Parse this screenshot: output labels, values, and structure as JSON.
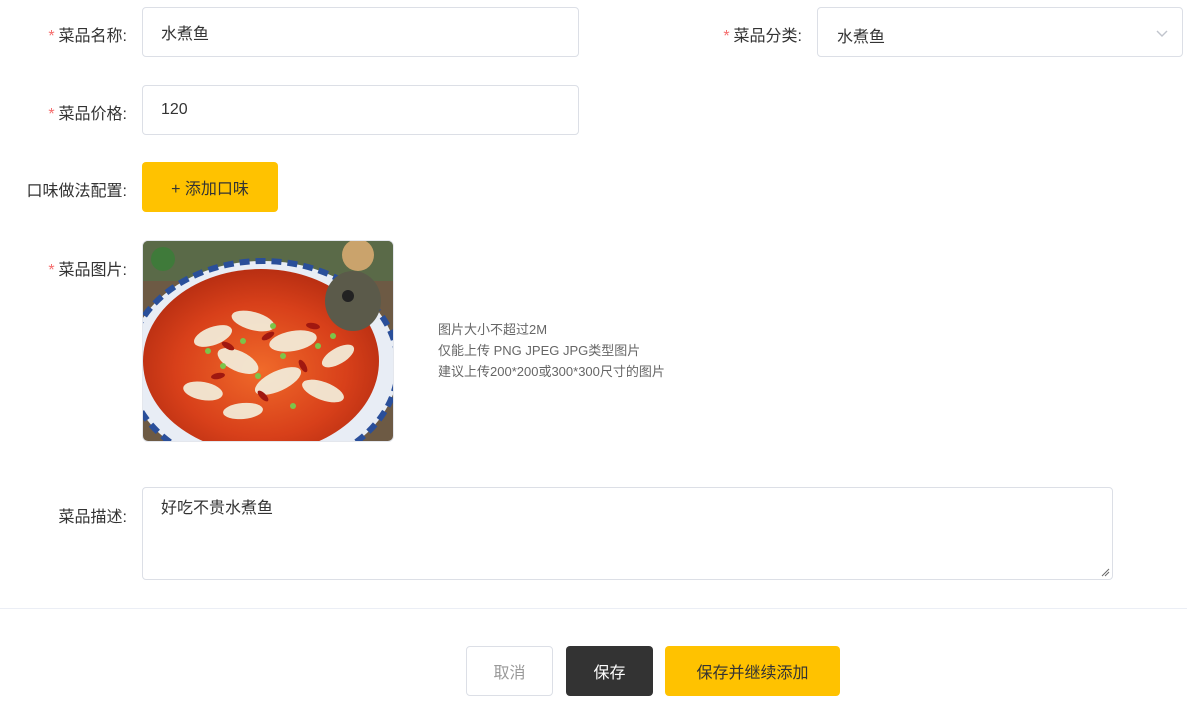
{
  "form": {
    "name": {
      "label": "菜品名称:",
      "required_mark": "*",
      "value": "水煮鱼"
    },
    "category": {
      "label": "菜品分类:",
      "required_mark": "*",
      "value": "水煮鱼",
      "icon": "chevron-down-icon"
    },
    "price": {
      "label": "菜品价格:",
      "required_mark": "*",
      "value": "120"
    },
    "flavor": {
      "label": "口味做法配置:",
      "add_button": "+ 添加口味"
    },
    "image": {
      "label": "菜品图片:",
      "required_mark": "*",
      "hints": [
        "图片大小不超过2M",
        "仅能上传 PNG JPEG JPG类型图片",
        "建议上传200*200或300*300尺寸的图片"
      ]
    },
    "description": {
      "label": "菜品描述:",
      "value": "好吃不贵水煮鱼"
    }
  },
  "actions": {
    "cancel": "取消",
    "save": "保存",
    "save_continue": "保存并继续添加"
  },
  "colors": {
    "accent": "#ffc200",
    "dark_button": "#333333",
    "required": "#f56c6c",
    "border": "#dcdfe6"
  }
}
